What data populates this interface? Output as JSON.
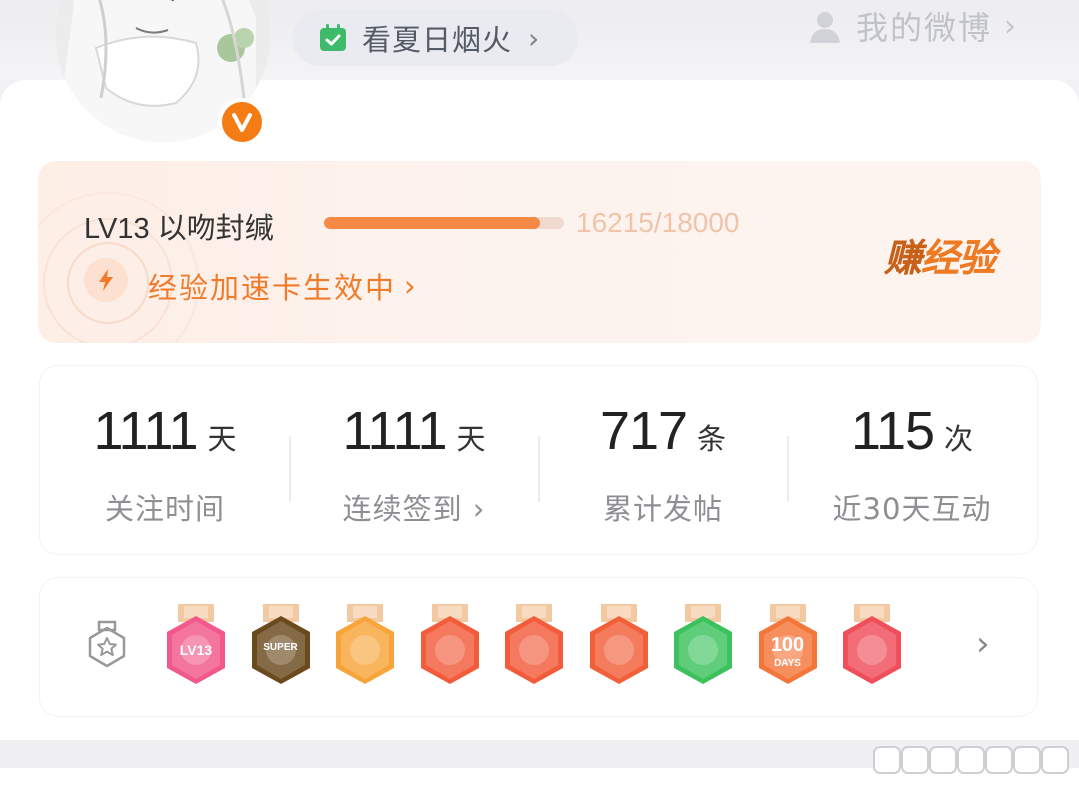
{
  "header": {
    "summer_label": "看夏日烟火",
    "summer_chevron": "›",
    "my_weibo_label": "我的微博",
    "my_weibo_chevron": "›"
  },
  "avatar": {
    "verified_badge": "V"
  },
  "level": {
    "title": "LV13 以吻封缄",
    "progress_fraction": 0.9,
    "exp_text": "16215/18000",
    "boost_label": "经验加速卡生效中",
    "boost_chevron": "›",
    "earn_label_a": "赚",
    "earn_label_b": "经验"
  },
  "stats": [
    {
      "value": "1111",
      "unit": "天",
      "label": "关注时间"
    },
    {
      "value": "1111",
      "unit": "天",
      "label": "连续签到 ›"
    },
    {
      "value": "717",
      "unit": "条",
      "label": "累计发帖"
    },
    {
      "value": "115",
      "unit": "次",
      "label": "近30天互动"
    }
  ],
  "badges": {
    "items": [
      {
        "icon": "lv13-badge",
        "text": "LV13",
        "color": "#f2588a"
      },
      {
        "icon": "super-badge",
        "text": "SUPER",
        "color": "#6b4a1e"
      },
      {
        "icon": "crown-badge",
        "text": "",
        "color": "#f7a53a"
      },
      {
        "icon": "dragon-badge-1",
        "text": "",
        "color": "#f25c3b"
      },
      {
        "icon": "dragon-badge-2",
        "text": "",
        "color": "#f25c3b"
      },
      {
        "icon": "dragon-badge-3",
        "text": "",
        "color": "#f2603a"
      },
      {
        "icon": "hand-badge",
        "text": "",
        "color": "#3cc25d"
      },
      {
        "icon": "100days-badge",
        "text": "100",
        "subtext": "DAYS",
        "color": "#f4773a"
      },
      {
        "icon": "trophy-badge",
        "text": "",
        "color": "#ef4e5a"
      }
    ],
    "more_chevron": "›"
  },
  "colors": {
    "accent": "#f07b2a",
    "progress_fill": "#f48a46",
    "verified": "#f57c14"
  }
}
